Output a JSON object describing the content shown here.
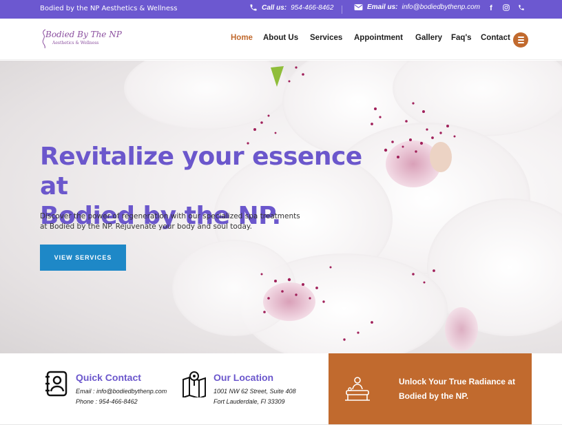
{
  "topbar": {
    "tagline": "Bodied by the NP Aesthetics & Wellness",
    "call_label": "Call us:",
    "call_value": "954-466-8462",
    "email_label": "Email us:",
    "email_value": "info@bodiedbythenp.com",
    "social": [
      "facebook-icon",
      "instagram-icon",
      "phone-icon"
    ]
  },
  "logo": {
    "script": "Bodied By The NP",
    "sub": "Aesthetics & Wellness"
  },
  "nav": {
    "items": [
      "Home",
      "About Us",
      "Services",
      "Appointment",
      "Gallery",
      "Faq's",
      "Contact"
    ],
    "active": "Home"
  },
  "hero": {
    "title_line1": "Revitalize your essence at",
    "title_line2": "Bodied by the NP.",
    "paragraph": "Discover the power of regeneration with our specialized spa treatments at Bodied by the NP. Rejuvenate your body and soul today.",
    "cta_label": "VIEW SERVICES"
  },
  "info": {
    "quick_contact": {
      "title": "Quick Contact",
      "email": "Email : info@bodiedbythenp.com",
      "phone": "Phone : 954-466-8462"
    },
    "location": {
      "title": "Our Location",
      "address1": "1001 NW 62 Street, Suite 408",
      "address2": "Fort Lauderdale, Fl 33309"
    },
    "promo": {
      "text": "Unlock Your True Radiance at Bodied by the NP."
    }
  },
  "colors": {
    "brand_purple": "#6b57cc",
    "accent_copper": "#c16a2e",
    "cta_blue": "#1e88c7"
  }
}
